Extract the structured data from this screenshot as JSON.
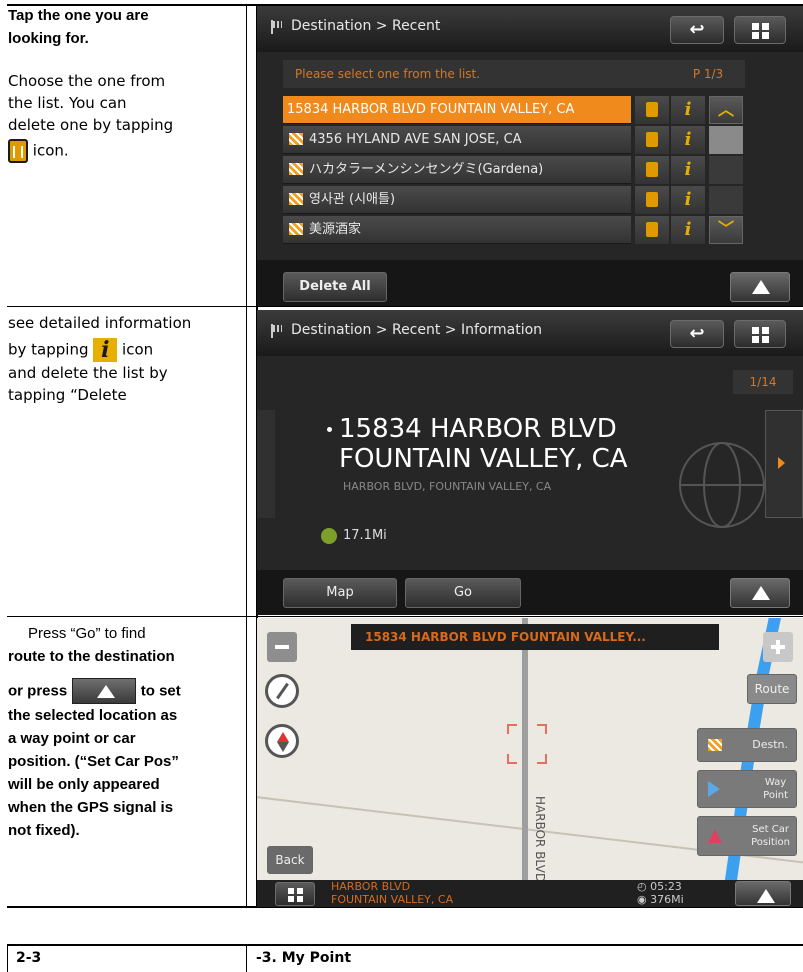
{
  "rows": [
    {
      "text_lines": [
        "Tap the one you are",
        "looking for."
      ],
      "desc_lines_a": [
        "Choose the one from",
        "the list.  You can",
        "delete one by tapping"
      ],
      "desc_after_icon": "icon."
    },
    {
      "line1": "see detailed information",
      "line2_pre": "by tapping",
      "line2_post": "icon",
      "line3": "and delete the list by",
      "line4": "tapping “Delete"
    },
    {
      "line1": "Press “Go” to find",
      "line2": "route to the destination",
      "line3_pre": "or press",
      "line3_post": "to set",
      "lines_rest": [
        "the selected location as",
        "a way point or car",
        "position. (“Set Car Pos”",
        "will be only appeared",
        "when the GPS signal is",
        "not fixed)."
      ]
    }
  ],
  "screen1": {
    "title": "Destination > Recent",
    "subtitle": "Please select one from the list.",
    "page": "P 1/3",
    "items": [
      "15834 HARBOR BLVD FOUNTAIN VALLEY, CA",
      "4356 HYLAND AVE SAN JOSE, CA",
      "ハカタラーメンシンセングミ(Gardena)",
      "영사관 (시애틀)",
      "美源酒家"
    ],
    "delete_all": "Delete All"
  },
  "screen2": {
    "title": "Destination > Recent > Information",
    "page": "1/14",
    "addr1": "15834 HARBOR BLVD",
    "addr2": "FOUNTAIN VALLEY, CA",
    "sub": "HARBOR BLVD, FOUNTAIN VALLEY, CA",
    "distance": "17.1Mi",
    "map": "Map",
    "go": "Go"
  },
  "screen3": {
    "banner": "15834 HARBOR BLVD FOUNTAIN VALLEY...",
    "route": "Route",
    "destn": "Destn.",
    "way1": "Way",
    "way2": "Point",
    "car1": "Set Car",
    "car2": "Position",
    "street": "HARBOR BLVD",
    "back": "Back",
    "foot1": "HARBOR BLVD",
    "foot2": "FOUNTAIN VALLEY, CA",
    "time": "05:23",
    "dist": "376Mi"
  },
  "footer": {
    "left": "2-3",
    "right": "-3. My Point"
  }
}
